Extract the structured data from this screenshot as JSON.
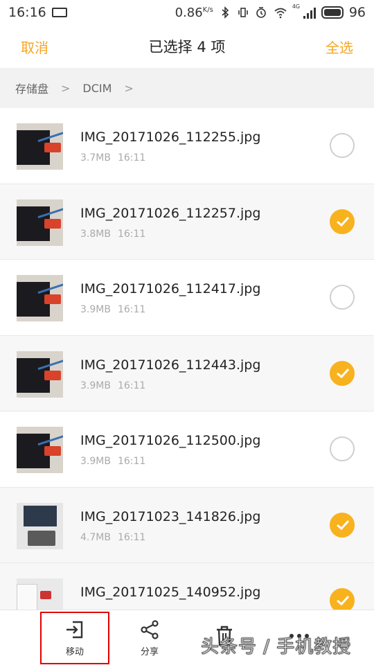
{
  "status_bar": {
    "time": "16:16",
    "speed": "0.86",
    "speed_unit": "K/s",
    "signal_label": "4G",
    "battery": "96"
  },
  "header": {
    "cancel_label": "取消",
    "title": "已选择 4 项",
    "select_all_label": "全选",
    "accent_color": "#f5a623"
  },
  "breadcrumb": {
    "items": [
      "存储盘",
      "DCIM"
    ]
  },
  "files": [
    {
      "name": "IMG_20171026_112255.jpg",
      "size": "3.7MB",
      "time": "16:11",
      "selected": false
    },
    {
      "name": "IMG_20171026_112257.jpg",
      "size": "3.8MB",
      "time": "16:11",
      "selected": true
    },
    {
      "name": "IMG_20171026_112417.jpg",
      "size": "3.9MB",
      "time": "16:11",
      "selected": false
    },
    {
      "name": "IMG_20171026_112443.jpg",
      "size": "3.9MB",
      "time": "16:11",
      "selected": true
    },
    {
      "name": "IMG_20171026_112500.jpg",
      "size": "3.9MB",
      "time": "16:11",
      "selected": false
    },
    {
      "name": "IMG_20171023_141826.jpg",
      "size": "4.7MB",
      "time": "16:11",
      "selected": true
    },
    {
      "name": "IMG_20171025_140952.jpg",
      "size": "",
      "time": "",
      "selected": true
    }
  ],
  "toolbar": {
    "move_label": "移动",
    "share_label": "分享",
    "delete_label": "",
    "more_label": ""
  },
  "watermark": "头条号 / 手机教授"
}
